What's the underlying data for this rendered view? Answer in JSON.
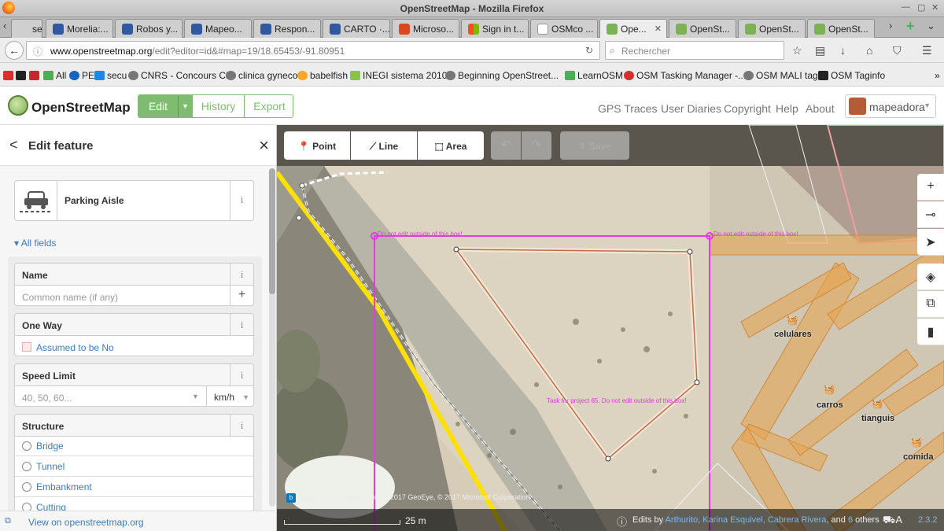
{
  "window": {
    "title": "OpenStreetMap - Mozilla Firefox"
  },
  "tabs": [
    {
      "label": "se..."
    },
    {
      "label": "Morelia:..."
    },
    {
      "label": "Robos y..."
    },
    {
      "label": "Mapeo..."
    },
    {
      "label": "Respon..."
    },
    {
      "label": "CARTO ·..."
    },
    {
      "label": "Microso..."
    },
    {
      "label": "Sign in t..."
    },
    {
      "label": "OSMco ..."
    },
    {
      "label": "Ope..."
    },
    {
      "label": "OpenSt..."
    },
    {
      "label": "OpenSt..."
    },
    {
      "label": "OpenSt..."
    }
  ],
  "urlbar": {
    "host": "www.openstreetmap.org",
    "path": "/edit?editor=id&#map=19/18.65453/-91.80951"
  },
  "search": {
    "placeholder": "Rechercher"
  },
  "bookmarks": [
    {
      "label": "All"
    },
    {
      "label": "PE"
    },
    {
      "label": "secu"
    },
    {
      "label": "CNRS - Concours CR"
    },
    {
      "label": "clinica gyneco"
    },
    {
      "label": "babelfish"
    },
    {
      "label": "INEGI sistema 2010"
    },
    {
      "label": "Beginning OpenStreet..."
    },
    {
      "label": "LearnOSM"
    },
    {
      "label": "OSM Tasking Manager -..."
    },
    {
      "label": "OSM MALI tag"
    },
    {
      "label": "OSM Taginfo"
    }
  ],
  "osm": {
    "logo": "OpenStreetMap",
    "edit": "Edit",
    "history": "History",
    "export": "Export",
    "nav": [
      "GPS Traces",
      "User Diaries",
      "Copyright",
      "Help",
      "About"
    ],
    "user": "mapeadora"
  },
  "sidebar": {
    "title": "Edit feature",
    "preset": "Parking Aisle",
    "all_fields": "All fields",
    "fields": {
      "name_label": "Name",
      "name_placeholder": "Common name (if any)",
      "oneway_label": "One Way",
      "oneway_value": "Assumed to be No",
      "speed_label": "Speed Limit",
      "speed_placeholder": "40, 50, 60...",
      "speed_unit": "km/h",
      "structure_label": "Structure",
      "structure_options": [
        "Bridge",
        "Tunnel",
        "Embankment",
        "Cutting"
      ]
    },
    "footer_link": "View on openstreetmap.org"
  },
  "toolbar": {
    "point": "Point",
    "line": "Line",
    "area": "Area",
    "save": "Save"
  },
  "map": {
    "warning_top": "Do not edit outside of this box!",
    "warning_right": "Do not edit outside of this box!",
    "task_label": "Task for project 65. Do not edit outside of this box!",
    "pois": [
      "celulares",
      "carros",
      "tianguis",
      "comida"
    ],
    "attribution_brand": "Bing",
    "attribution": "© 2017 DigitalGlobe, © 2017 GeoEye, © 2017 Microsoft Corporation",
    "scale": "25 m",
    "edits_prefix": "Edits by",
    "editors": "Arthurito, Karina Esquivel, Cabrera Rivera,",
    "and_text": "and",
    "others_count": "6",
    "others_text": "others",
    "version": "2.3.2"
  },
  "colors": {
    "accent": "#7ebc6f",
    "link": "#3f7ab6",
    "task_box": "#e33be0",
    "parking": "#e8a44c"
  }
}
